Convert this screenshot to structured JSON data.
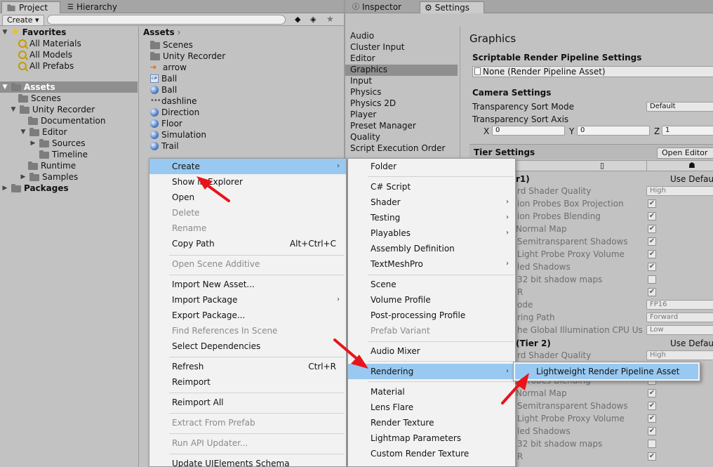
{
  "left_tabs": {
    "project": "Project",
    "hierarchy": "Hierarchy"
  },
  "right_tabs": {
    "inspector": "Inspector",
    "settings": "Settings"
  },
  "create_button": "Create",
  "favorites": {
    "title": "Favorites",
    "items": [
      "All Materials",
      "All Models",
      "All Prefabs"
    ]
  },
  "assets_tree": {
    "root": "Assets",
    "scenes": "Scenes",
    "unity_recorder": "Unity Recorder",
    "documentation": "Documentation",
    "editor": "Editor",
    "sources": "Sources",
    "timeline": "Timeline",
    "runtime": "Runtime",
    "samples": "Samples",
    "packages": "Packages"
  },
  "breadcrumb": "Assets",
  "asset_list": [
    "Scenes",
    "Unity Recorder",
    "arrow",
    "Ball",
    "Ball",
    "dashline",
    "Direction",
    "Floor",
    "Simulation",
    "Trail"
  ],
  "settings_list": [
    "Audio",
    "Cluster Input",
    "Editor",
    "Graphics",
    "Input",
    "Physics",
    "Physics 2D",
    "Player",
    "Preset Manager",
    "Quality",
    "Script Execution Order"
  ],
  "graphics": {
    "title": "Graphics",
    "srp_header": "Scriptable Render Pipeline Settings",
    "srp_value": "None (Render Pipeline Asset)",
    "camera_header": "Camera Settings",
    "sort_mode_label": "Transparency Sort Mode",
    "sort_mode_value": "Default",
    "sort_axis_label": "Transparency Sort Axis",
    "axis": {
      "x_label": "X",
      "x": "0",
      "y_label": "Y",
      "y": "0",
      "z_label": "Z",
      "z": "1"
    },
    "tier_header": "Tier Settings",
    "open_editor": "Open Editor",
    "tier1_label": "r1)",
    "use_default_1": "Use Defaul",
    "tier2_label": "(Tier 2)",
    "use_default_2": "Use Defaul",
    "rows": [
      "rd Shader Quality",
      "ion Probes Box Projection",
      "ion Probes Blending",
      "Normal Map",
      "Semitransparent Shadows",
      "Light Probe Proxy Volume",
      "led Shadows",
      "32 bit shadow maps",
      "R",
      "ode",
      "ring Path",
      "he Global Illumination CPU Us"
    ],
    "rows2": [
      "rd Shader Quality",
      "Probes Blending",
      "Normal Map",
      "Semitransparent Shadows",
      "Light Probe Proxy Volume",
      "led Shadows",
      "32 bit shadow maps",
      "R"
    ],
    "dd_high": "High",
    "dd_fp16": "FP16",
    "dd_forward": "Forward",
    "dd_low": "Low"
  },
  "context_menu": [
    {
      "label": "Create",
      "arrow": true
    },
    {
      "label": "Show in Explorer"
    },
    {
      "label": "Open"
    },
    {
      "label": "Delete"
    },
    {
      "label": "Rename"
    },
    {
      "label": "Copy Path",
      "shortcut": "Alt+Ctrl+C"
    },
    {
      "label": "Open Scene Additive"
    },
    {
      "label": "Import New Asset..."
    },
    {
      "label": "Import Package",
      "arrow": true
    },
    {
      "label": "Export Package..."
    },
    {
      "label": "Find References In Scene"
    },
    {
      "label": "Select Dependencies"
    },
    {
      "label": "Refresh",
      "shortcut": "Ctrl+R"
    },
    {
      "label": "Reimport"
    },
    {
      "label": "Reimport All"
    },
    {
      "label": "Extract From Prefab"
    },
    {
      "label": "Run API Updater..."
    },
    {
      "label": "Update UIElements Schema"
    }
  ],
  "create_menu": [
    {
      "label": "Folder"
    },
    {
      "label": "C# Script"
    },
    {
      "label": "Shader",
      "arrow": true
    },
    {
      "label": "Testing",
      "arrow": true
    },
    {
      "label": "Playables",
      "arrow": true
    },
    {
      "label": "Assembly Definition"
    },
    {
      "label": "TextMeshPro",
      "arrow": true
    },
    {
      "label": "Scene"
    },
    {
      "label": "Volume Profile"
    },
    {
      "label": "Post-processing Profile"
    },
    {
      "label": "Prefab Variant"
    },
    {
      "label": "Audio Mixer"
    },
    {
      "label": "Rendering",
      "arrow": true
    },
    {
      "label": "Material"
    },
    {
      "label": "Lens Flare"
    },
    {
      "label": "Render Texture"
    },
    {
      "label": "Lightmap Parameters"
    },
    {
      "label": "Custom Render Texture"
    }
  ],
  "rendering_menu": [
    "Lightweight Render Pipeline Asset"
  ],
  "colors": {
    "highlight": "#99c9f0",
    "annotation_arrow": "#e8141b",
    "selection": "#8f8f8f"
  }
}
